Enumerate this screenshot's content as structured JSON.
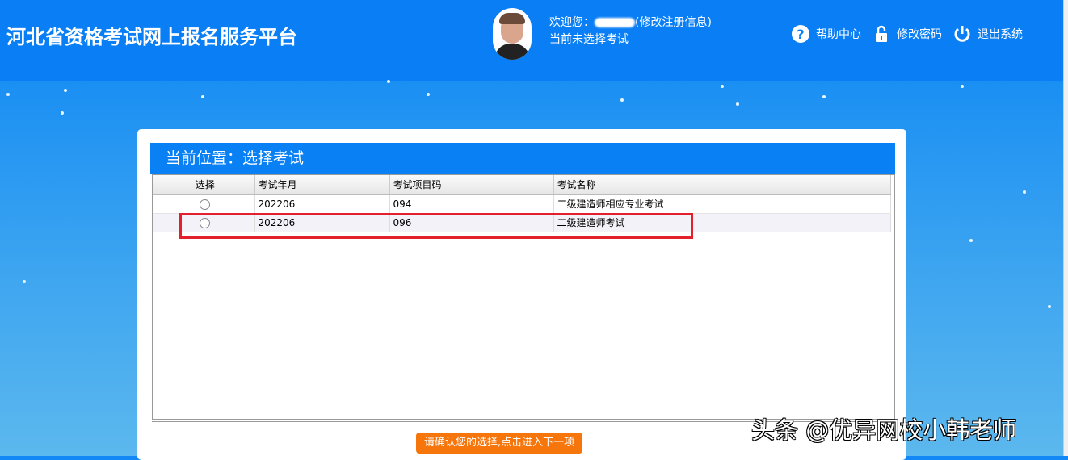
{
  "header": {
    "title": "河北省资格考试网上报名服务平台",
    "welcome_prefix": "欢迎您：",
    "edit_link": "(修改注册信息)",
    "status": "当前未选择考试",
    "links": [
      {
        "label": "帮助中心",
        "icon": "help-icon"
      },
      {
        "label": "修改密码",
        "icon": "unlock-icon"
      },
      {
        "label": "退出系统",
        "icon": "power-icon"
      }
    ]
  },
  "location": "当前位置：选择考试",
  "table": {
    "columns": [
      "选择",
      "考试年月",
      "考试项目码",
      "考试名称"
    ],
    "rows": [
      {
        "ym": "202206",
        "code": "094",
        "name": "二级建造师相应专业考试"
      },
      {
        "ym": "202206",
        "code": "096",
        "name": "二级建造师考试"
      }
    ]
  },
  "confirm_button": "请确认您的选择,点击进入下一项",
  "watermark": "头条 @优异网校小韩老师",
  "colors": {
    "header": "#0a7ef5",
    "highlight": "#e3202b",
    "button": "#f6760c"
  }
}
